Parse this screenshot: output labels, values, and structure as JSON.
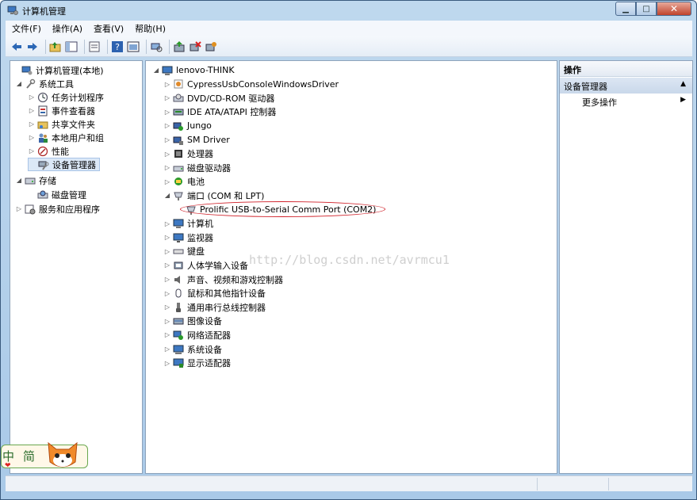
{
  "window": {
    "title": "计算机管理"
  },
  "menu": [
    "文件(F)",
    "操作(A)",
    "查看(V)",
    "帮助(H)"
  ],
  "toolbar_icons": [
    "back-icon",
    "forward-icon",
    "up-folder-icon",
    "show-tree-icon",
    "properties-icon",
    "help-icon",
    "console-icon",
    "scan-hardware-icon",
    "update-driver-icon",
    "uninstall-icon",
    "enable-icon"
  ],
  "left_tree": [
    {
      "label": "计算机管理(本地)",
      "icon": "computer-management-icon",
      "level": 0,
      "exp": ""
    },
    {
      "label": "系统工具",
      "icon": "tools-icon",
      "level": 1,
      "exp": "◢"
    },
    {
      "label": "任务计划程序",
      "icon": "clock-icon",
      "level": 2,
      "exp": "▷"
    },
    {
      "label": "事件查看器",
      "icon": "event-viewer-icon",
      "level": 2,
      "exp": "▷"
    },
    {
      "label": "共享文件夹",
      "icon": "shared-folder-icon",
      "level": 2,
      "exp": "▷"
    },
    {
      "label": "本地用户和组",
      "icon": "users-icon",
      "level": 2,
      "exp": "▷"
    },
    {
      "label": "性能",
      "icon": "performance-icon",
      "level": 2,
      "exp": "▷"
    },
    {
      "label": "设备管理器",
      "icon": "device-manager-icon",
      "level": 2,
      "exp": "",
      "selected": true
    },
    {
      "label": "存储",
      "icon": "storage-icon",
      "level": 1,
      "exp": "◢"
    },
    {
      "label": "磁盘管理",
      "icon": "disk-management-icon",
      "level": 2,
      "exp": ""
    },
    {
      "label": "服务和应用程序",
      "icon": "services-icon",
      "level": 1,
      "exp": "▷"
    }
  ],
  "device_tree": [
    {
      "label": "lenovo-THINK",
      "icon": "computer-icon",
      "level": 0,
      "exp": "◢"
    },
    {
      "label": "CypressUsbConsoleWindowsDriver",
      "icon": "driver-icon",
      "level": 1,
      "exp": "▷"
    },
    {
      "label": "DVD/CD-ROM 驱动器",
      "icon": "dvd-icon",
      "level": 1,
      "exp": "▷"
    },
    {
      "label": "IDE ATA/ATAPI 控制器",
      "icon": "ide-icon",
      "level": 1,
      "exp": "▷"
    },
    {
      "label": "Jungo",
      "icon": "jungo-icon",
      "level": 1,
      "exp": "▷"
    },
    {
      "label": "SM Driver",
      "icon": "sm-driver-icon",
      "level": 1,
      "exp": "▷"
    },
    {
      "label": "处理器",
      "icon": "processor-icon",
      "level": 1,
      "exp": "▷"
    },
    {
      "label": "磁盘驱动器",
      "icon": "disk-drive-icon",
      "level": 1,
      "exp": "▷"
    },
    {
      "label": "电池",
      "icon": "battery-icon",
      "level": 1,
      "exp": "▷"
    },
    {
      "label": "端口 (COM 和 LPT)",
      "icon": "port-icon",
      "level": 1,
      "exp": "◢"
    },
    {
      "label": "Prolific USB-to-Serial Comm Port (COM2)",
      "icon": "serial-port-icon",
      "level": 2,
      "exp": ""
    },
    {
      "label": "计算机",
      "icon": "computer-icon",
      "level": 1,
      "exp": "▷"
    },
    {
      "label": "监视器",
      "icon": "monitor-icon",
      "level": 1,
      "exp": "▷"
    },
    {
      "label": "键盘",
      "icon": "keyboard-icon",
      "level": 1,
      "exp": "▷"
    },
    {
      "label": "人体学输入设备",
      "icon": "hid-icon",
      "level": 1,
      "exp": "▷"
    },
    {
      "label": "声音、视频和游戏控制器",
      "icon": "sound-icon",
      "level": 1,
      "exp": "▷"
    },
    {
      "label": "鼠标和其他指针设备",
      "icon": "mouse-icon",
      "level": 1,
      "exp": "▷"
    },
    {
      "label": "通用串行总线控制器",
      "icon": "usb-icon",
      "level": 1,
      "exp": "▷"
    },
    {
      "label": "图像设备",
      "icon": "imaging-icon",
      "level": 1,
      "exp": "▷"
    },
    {
      "label": "网络适配器",
      "icon": "network-icon",
      "level": 1,
      "exp": "▷"
    },
    {
      "label": "系统设备",
      "icon": "system-device-icon",
      "level": 1,
      "exp": "▷"
    },
    {
      "label": "显示适配器",
      "icon": "display-adapter-icon",
      "level": 1,
      "exp": "▷"
    }
  ],
  "actions": {
    "header": "操作",
    "section": "设备管理器",
    "more": "更多操作"
  },
  "watermark": "http://blog.csdn.net/avrmcu1",
  "ime": {
    "zh": "中",
    "jian": "简"
  }
}
